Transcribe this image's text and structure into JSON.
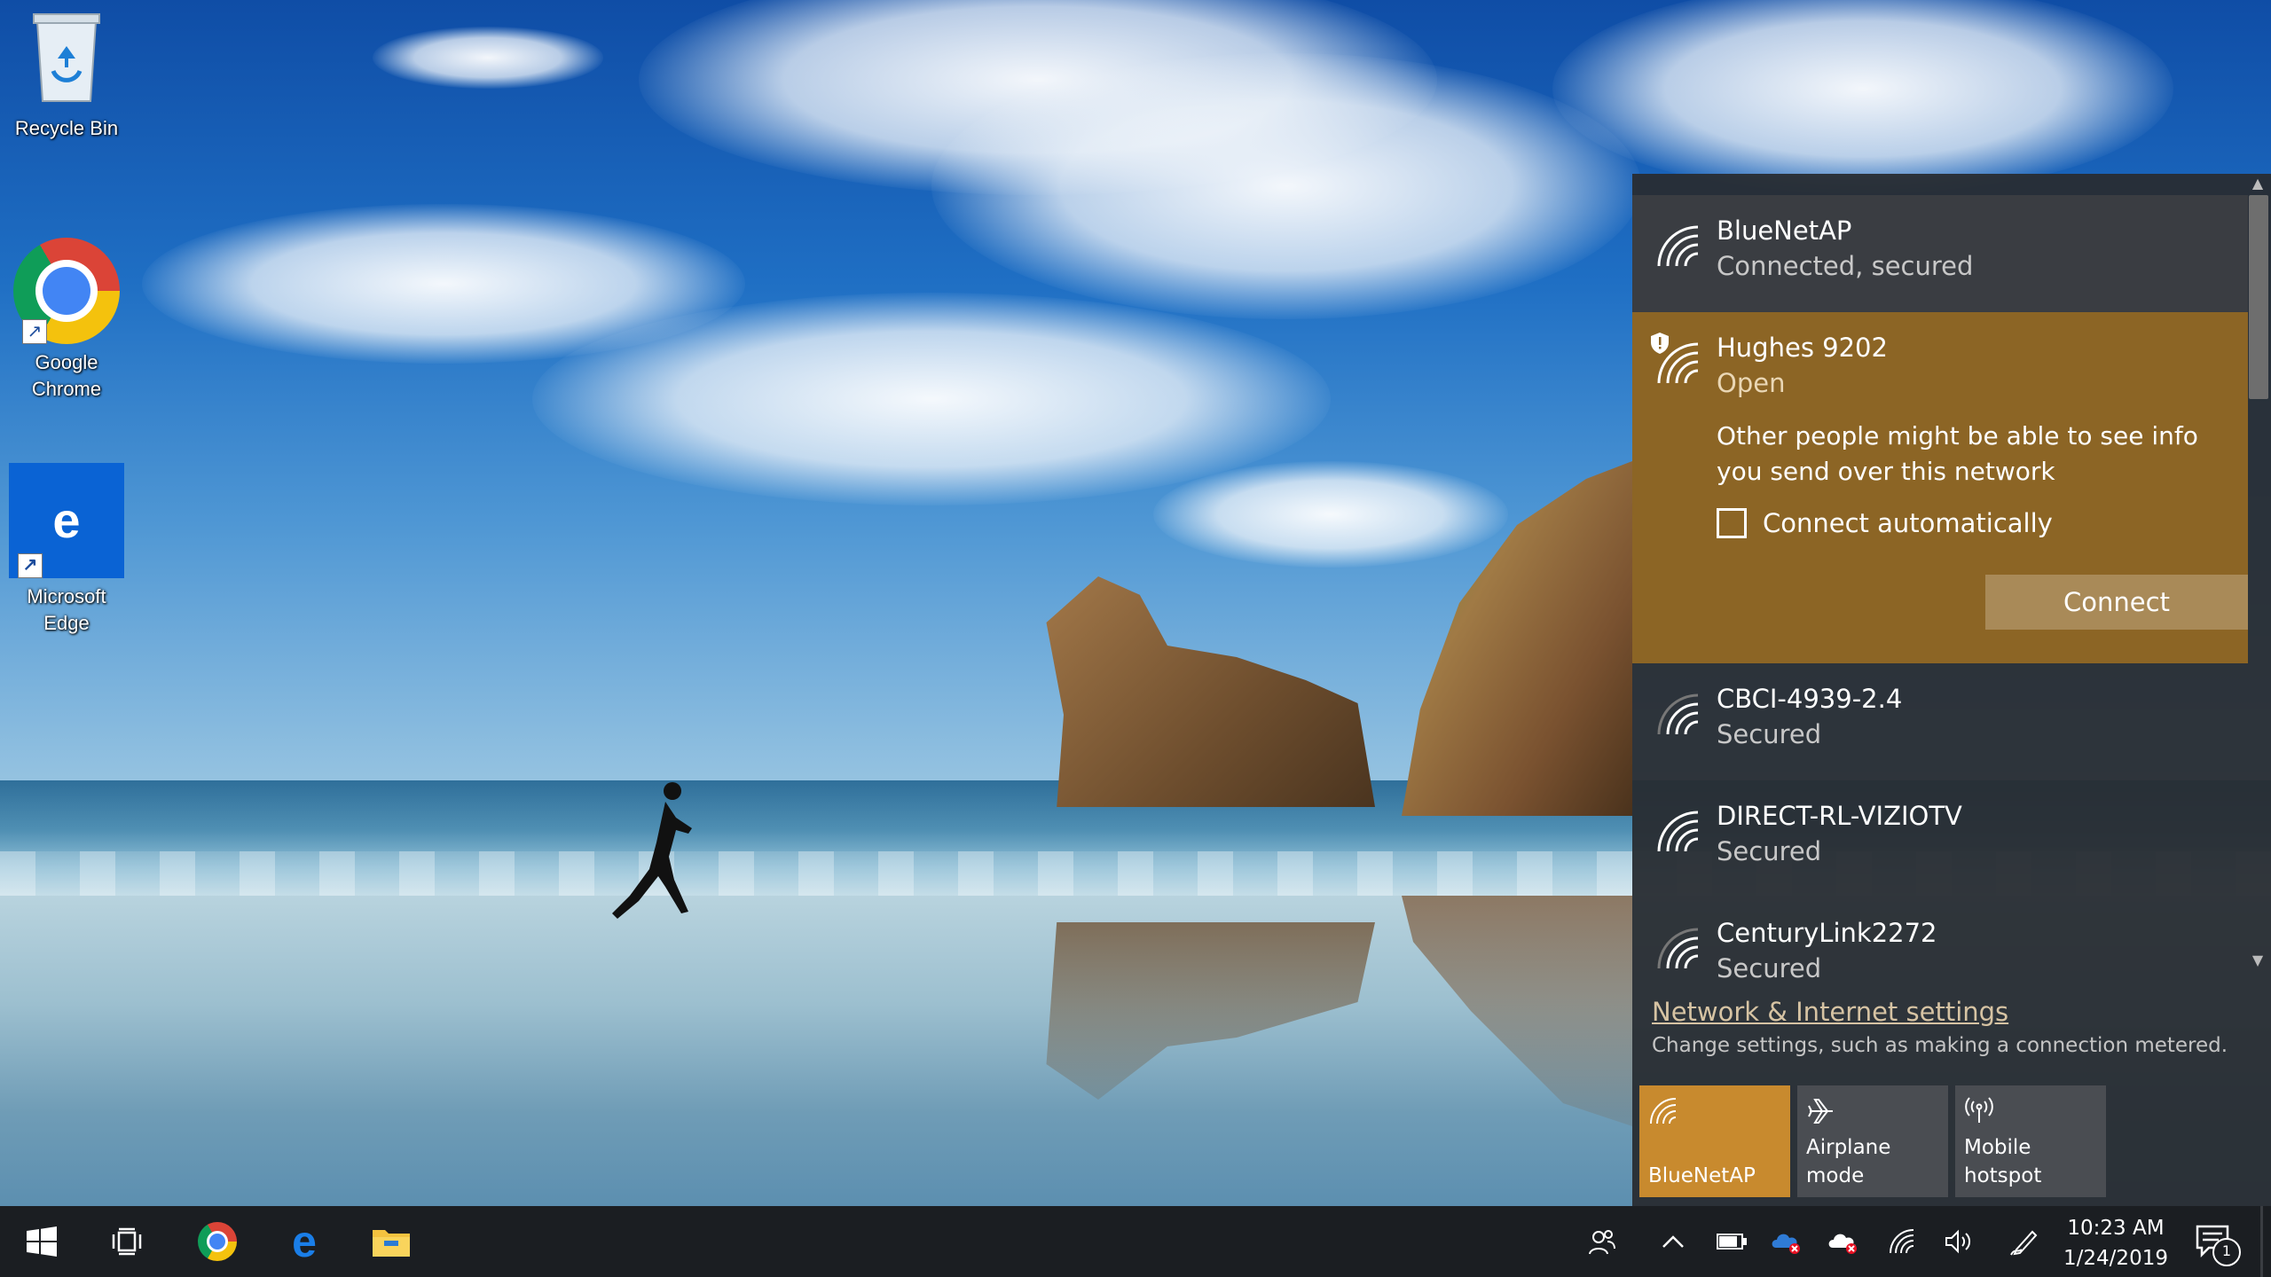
{
  "desktop": {
    "icons": [
      {
        "label": "Recycle Bin"
      },
      {
        "label": "Google Chrome"
      },
      {
        "label": "Microsoft Edge"
      }
    ]
  },
  "network_flyout": {
    "networks": [
      {
        "name": "BlueNetAP",
        "status": "Connected, secured",
        "state": "connected"
      },
      {
        "name": "Hughes 9202",
        "status": "Open",
        "state": "expanded",
        "warning": "Other people might be able to see info you send over this network",
        "auto_connect_label": "Connect automatically",
        "auto_connect_checked": false,
        "connect_label": "Connect"
      },
      {
        "name": "CBCI-4939-2.4",
        "status": "Secured"
      },
      {
        "name": "DIRECT-RL-VIZIOTV",
        "status": "Secured"
      },
      {
        "name": "CenturyLink2272",
        "status": "Secured"
      }
    ],
    "settings_link": "Network & Internet settings",
    "settings_desc": "Change settings, such as making a connection metered.",
    "quick_actions": [
      {
        "label": "BlueNetAP",
        "icon": "wifi-icon",
        "active": true
      },
      {
        "label": "Airplane mode",
        "icon": "airplane-icon",
        "active": false
      },
      {
        "label": "Mobile hotspot",
        "icon": "hotspot-icon",
        "active": false
      }
    ]
  },
  "taskbar": {
    "pinned": [
      "start-button",
      "task-view",
      "google-chrome",
      "microsoft-edge",
      "file-explorer"
    ],
    "clock_time": "10:23 AM",
    "clock_date": "1/24/2019",
    "notification_count": "1"
  },
  "colors": {
    "accent": "#c88a2e",
    "expanded_bg": "#8c6525",
    "flyout_bg": "#282c32",
    "taskbar_bg": "#1b1e22"
  }
}
